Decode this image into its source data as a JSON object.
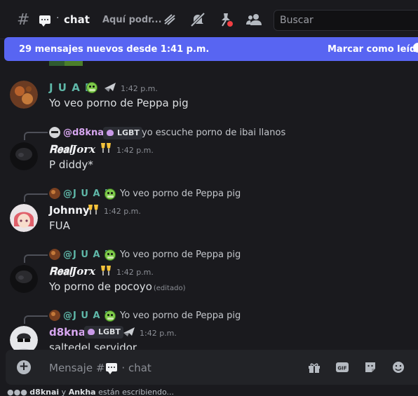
{
  "header": {
    "hash": "#",
    "separator": "·",
    "channel_name": "chat",
    "topic": "Aquí podr...",
    "search_placeholder": "Buscar",
    "icons": [
      "threads-icon",
      "mute-icon",
      "pinned-icon",
      "members-icon"
    ]
  },
  "new_messages": {
    "text": "29 mensajes nuevos desde 1:41 p.m.",
    "action": "Marcar como leído"
  },
  "messages": [
    {
      "author": "J U A N",
      "author_color": "#5fb7a8",
      "time": "1:42 p.m.",
      "content": "Yo veo porno de Peppa pig"
    },
    {
      "reply_to_name": "@d8knai",
      "reply_tag": "LGBT",
      "reply_text": "yo escuche porno de ibai llanos",
      "author": "𝐑𝐞𝐚𝐥𝑱𝒐𝒓𝒙",
      "author_color": "#f2f3f5",
      "time": "1:42 p.m.",
      "content": "P diddy*"
    },
    {
      "reply_to_name": "@J U A N",
      "reply_text": "Yo veo porno de Peppa pig",
      "author": "Johnny",
      "author_color": "#f2f3f5",
      "time": "1:42 p.m.",
      "content": "FUA"
    },
    {
      "reply_to_name": "@J U A N",
      "reply_text": "Yo veo porno de Peppa pig",
      "author": "𝐑𝐞𝐚𝐥𝑱𝒐𝒓𝒙",
      "author_color": "#f2f3f5",
      "time": "1:42 p.m.",
      "content": "Yo porno de pocoyo",
      "edited": "(editado)"
    },
    {
      "reply_to_name": "@J U A N",
      "reply_text": "Yo veo porno de Peppa pig",
      "author": "d8knai",
      "author_color": "#d7a6f0",
      "tag": "LGBT",
      "time": "1:42 p.m.",
      "content": "saltedel servidor"
    }
  ],
  "composer": {
    "placeholder_prefix": "Mensaje #",
    "placeholder_sep": "·",
    "placeholder_channel": "chat",
    "icons": [
      "gift-icon",
      "gif-icon",
      "sticker-icon",
      "emoji-icon"
    ]
  },
  "typing": {
    "user1": "d8knai",
    "conj": "y",
    "user2": "Ankha",
    "suffix": "están escribiendo..."
  },
  "colors": {
    "accent": "#5865f2",
    "background": "#1a1a1e",
    "name_juan": "#5fb7a8",
    "name_d8knai": "#d7a6f0"
  }
}
